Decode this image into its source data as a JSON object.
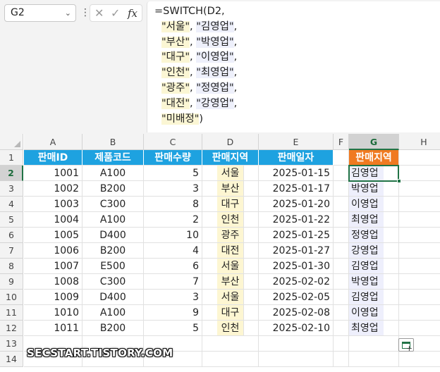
{
  "name_box": {
    "value": "G2"
  },
  "formula_bar": {
    "dots": "⋮",
    "cancel_icon": "✕",
    "enter_icon": "✓",
    "fx_label": "fx",
    "lines": [
      "=SWITCH(D2,",
      "\"서울\", \"김영업\",",
      "\"부산\", \"박영업\",",
      "\"대구\", \"이영업\",",
      "\"인천\", \"최영업\",",
      "\"광주\", \"정영업\",",
      "\"대전\", \"강영업\",",
      "\"미배정\")"
    ]
  },
  "columns": [
    "A",
    "B",
    "C",
    "D",
    "E",
    "F",
    "G",
    "H"
  ],
  "rows": [
    "1",
    "2",
    "3",
    "4",
    "5",
    "6",
    "7",
    "8",
    "9",
    "10",
    "11",
    "12",
    "13",
    "14"
  ],
  "table": {
    "headers": [
      "판매ID",
      "제품코드",
      "판매수량",
      "판매지역",
      "판매일자"
    ],
    "records": [
      [
        "1001",
        "A100",
        "5",
        "서울",
        "2025-01-15"
      ],
      [
        "1002",
        "B200",
        "3",
        "부산",
        "2025-01-17"
      ],
      [
        "1003",
        "C300",
        "8",
        "대구",
        "2025-01-20"
      ],
      [
        "1004",
        "A100",
        "2",
        "인천",
        "2025-01-22"
      ],
      [
        "1005",
        "D400",
        "10",
        "광주",
        "2025-01-25"
      ],
      [
        "1006",
        "B200",
        "4",
        "대전",
        "2025-01-27"
      ],
      [
        "1007",
        "E500",
        "6",
        "서울",
        "2025-01-30"
      ],
      [
        "1008",
        "C300",
        "7",
        "부산",
        "2025-02-02"
      ],
      [
        "1009",
        "D400",
        "3",
        "서울",
        "2025-02-05"
      ],
      [
        "1010",
        "A100",
        "9",
        "대구",
        "2025-02-08"
      ],
      [
        "1011",
        "B200",
        "5",
        "인천",
        "2025-02-10"
      ]
    ]
  },
  "result": {
    "header": "판매지역",
    "values": [
      "김영업",
      "박영업",
      "이영업",
      "최영업",
      "정영업",
      "강영업",
      "김영업",
      "박영업",
      "김영업",
      "이영업",
      "최영업"
    ]
  },
  "watermark": "SECSTART.TISTORY.COM",
  "colors": {
    "header_blue": "#1ea2e0",
    "header_orange": "#f07a21",
    "selection_green": "#217346",
    "region_fill": "#fdf6d2",
    "result_fill": "#eeeffc"
  }
}
